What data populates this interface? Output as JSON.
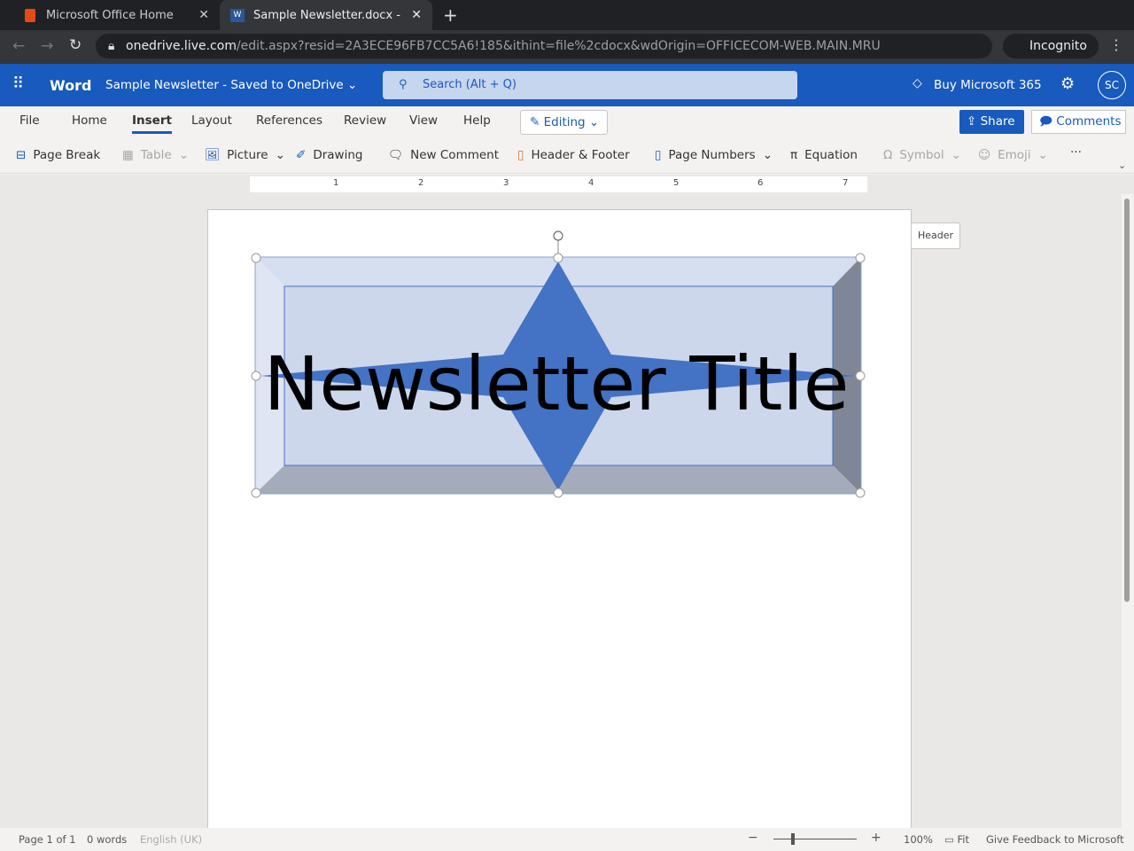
{
  "browser": {
    "tabs": [
      {
        "title": "Microsoft Office Home"
      },
      {
        "title": "Sample Newsletter.docx - "
      }
    ],
    "url_host": "onedrive.live.com",
    "url_path": "/edit.aspx?resid=2A3ECE96FB7CC5A6!185&ithint=file%2cdocx&wdOrigin=OFFICECOM-WEB.MAIN.MRU",
    "profile": "Incognito"
  },
  "app": {
    "name": "Word",
    "doc_title": "Sample Newsletter",
    "save_status": "Saved to OneDrive",
    "search_placeholder": "Search (Alt + Q)",
    "buy": "Buy Microsoft 365",
    "avatar": "SC"
  },
  "menu": {
    "items": [
      "File",
      "Home",
      "Insert",
      "Layout",
      "References",
      "Review",
      "View",
      "Help"
    ],
    "editing": "Editing",
    "share": "Share",
    "comments": "Comments"
  },
  "ribbon": {
    "items": [
      "Page Break",
      "Table",
      "Picture",
      "Drawing",
      "New Comment",
      "Header & Footer",
      "Page Numbers",
      "Equation",
      "Symbol",
      "Emoji"
    ],
    "more": "···"
  },
  "ruler": {
    "ticks": [
      "1",
      "2",
      "3",
      "4",
      "5",
      "6",
      "7"
    ]
  },
  "document": {
    "title_text": "Newsletter Title",
    "header_tooltip": "Header"
  },
  "status": {
    "page": "Page 1 of 1",
    "words": "0 words",
    "language": "English (UK)",
    "zoom": "100%",
    "fit": "Fit",
    "feedback": "Give Feedback to Microsoft"
  },
  "colors": {
    "accent": "#185abd",
    "star": "#4472c4",
    "bevel": "#d3dcef"
  }
}
